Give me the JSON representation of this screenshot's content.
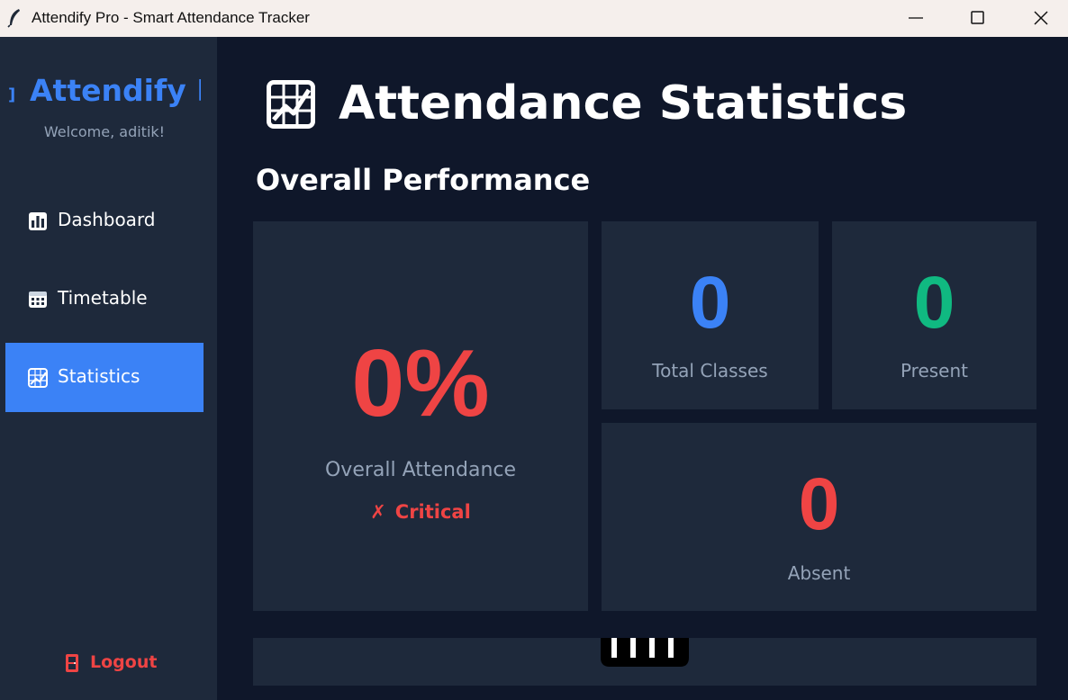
{
  "window": {
    "title": "Attendify Pro - Smart Attendance Tracker"
  },
  "sidebar": {
    "brand": "Attendify P",
    "welcome": "Welcome, aditik!",
    "items": [
      {
        "label": "Dashboard",
        "icon": "bar-chart-icon",
        "active": false
      },
      {
        "label": "Timetable",
        "icon": "calendar-icon",
        "active": false
      },
      {
        "label": "Statistics",
        "icon": "chart-increasing-icon",
        "active": true
      }
    ],
    "logout_label": "Logout"
  },
  "main": {
    "page_title": "Attendance Statistics",
    "section_title": "Overall Performance",
    "overall": {
      "value": "0%",
      "label": "Overall Attendance",
      "status_mark": "✗",
      "status_text": "Critical"
    },
    "stats": {
      "total": {
        "value": "0",
        "label": "Total Classes"
      },
      "present": {
        "value": "0",
        "label": "Present"
      },
      "absent": {
        "value": "0",
        "label": "Absent"
      }
    }
  },
  "colors": {
    "accent": "#3b82f6",
    "critical": "#ef4444",
    "present": "#10b981",
    "sidebar_bg": "#1e293b",
    "main_bg": "#0f172a",
    "card_bg": "#1e293b",
    "muted_text": "#94a3b8"
  }
}
